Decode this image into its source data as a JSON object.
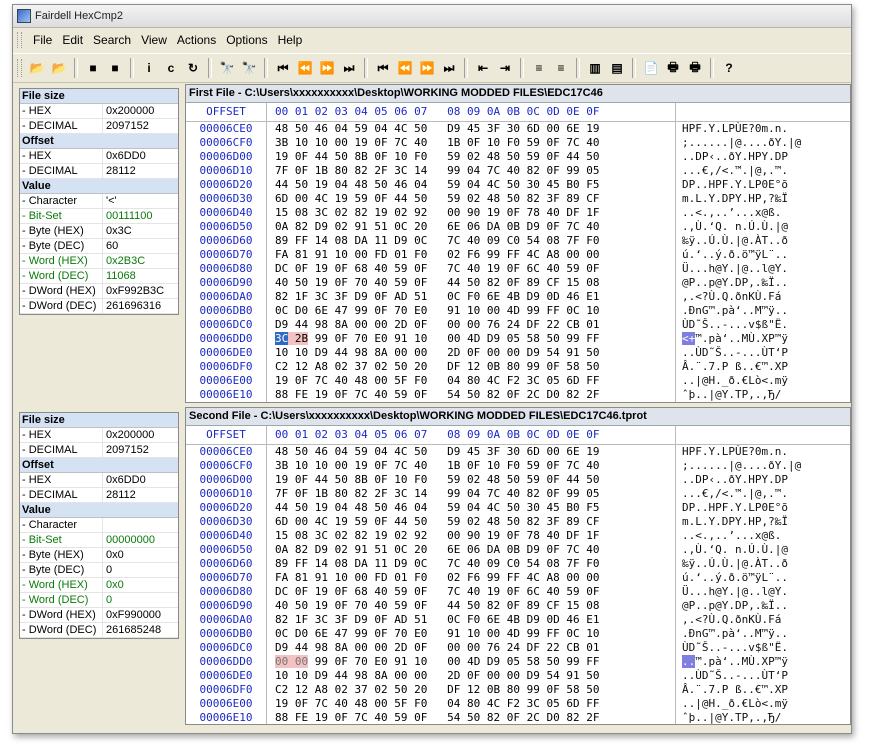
{
  "window": {
    "title": "Fairdell HexCmp2"
  },
  "menu": [
    "File",
    "Edit",
    "Search",
    "View",
    "Actions",
    "Options",
    "Help"
  ],
  "toolbar": [
    {
      "name": "open-first-icon",
      "glyph": "📂"
    },
    {
      "name": "open-second-icon",
      "glyph": "📂"
    },
    {
      "sep": true
    },
    {
      "name": "stop-icon",
      "glyph": "■"
    },
    {
      "name": "stop2-icon",
      "glyph": "■"
    },
    {
      "sep": true
    },
    {
      "name": "info-icon",
      "glyph": "i"
    },
    {
      "name": "compare-icon",
      "glyph": "c"
    },
    {
      "name": "refresh-icon",
      "glyph": "↻"
    },
    {
      "sep": true
    },
    {
      "name": "find-icon",
      "glyph": "🔭"
    },
    {
      "name": "find-next-icon",
      "glyph": "🔭"
    },
    {
      "sep": true
    },
    {
      "name": "first-diff-icon",
      "glyph": "⏮"
    },
    {
      "name": "prev-diff-icon",
      "glyph": "⏪"
    },
    {
      "name": "next-diff-icon",
      "glyph": "⏩"
    },
    {
      "name": "last-diff-icon",
      "glyph": "⏭"
    },
    {
      "sep": true
    },
    {
      "name": "first-block-icon",
      "glyph": "⏮"
    },
    {
      "name": "prev-block-icon",
      "glyph": "⏪"
    },
    {
      "name": "next-block-icon",
      "glyph": "⏩"
    },
    {
      "name": "last-block-icon",
      "glyph": "⏭"
    },
    {
      "sep": true
    },
    {
      "name": "sync-left-icon",
      "glyph": "⇤"
    },
    {
      "name": "sync-right-icon",
      "glyph": "⇥"
    },
    {
      "sep": true
    },
    {
      "name": "align-top-icon",
      "glyph": "≡"
    },
    {
      "name": "align-bottom-icon",
      "glyph": "≡"
    },
    {
      "sep": true
    },
    {
      "name": "columns-icon",
      "glyph": "▥"
    },
    {
      "name": "rows-icon",
      "glyph": "▤"
    },
    {
      "sep": true
    },
    {
      "name": "report-icon",
      "glyph": "📄"
    },
    {
      "name": "print-icon",
      "glyph": "🖶"
    },
    {
      "name": "print-preview-icon",
      "glyph": "🖶"
    },
    {
      "sep": true
    },
    {
      "name": "help-icon",
      "glyph": "?"
    }
  ],
  "col_header": {
    "offset": "OFFSET",
    "hex": "00 01 02 03 04 05 06 07   08 09 0A 0B 0C 0D 0E 0F"
  },
  "panels": [
    {
      "title": "First File - C:\\Users\\xxxxxxxxxx\\Desktop\\WORKING MODDED FILES\\EDC17C46",
      "info": [
        {
          "h": "File size"
        },
        {
          "k": " - HEX",
          "v": "0x200000"
        },
        {
          "k": " - DECIMAL",
          "v": "2097152"
        },
        {
          "h": "Offset"
        },
        {
          "k": " - HEX",
          "v": "0x6DD0"
        },
        {
          "k": " - DECIMAL",
          "v": "28112"
        },
        {
          "h": "Value"
        },
        {
          "k": " - Character",
          "v": "'<'"
        },
        {
          "k": " - Bit-Set",
          "v": "00111100",
          "g": true
        },
        {
          "k": " - Byte (HEX)",
          "v": "0x3C"
        },
        {
          "k": " - Byte (DEC)",
          "v": "60"
        },
        {
          "k": " - Word (HEX)",
          "v": "0x2B3C",
          "g": true
        },
        {
          "k": " - Word (DEC)",
          "v": "11068",
          "g": true
        },
        {
          "k": " - DWord (HEX)",
          "v": "0xF992B3C"
        },
        {
          "k": " - DWord (DEC)",
          "v": "261696316"
        }
      ],
      "rows": [
        [
          "00006CE0",
          "48 50 46 04 59 04 4C 50   D9 45 3F 30 6D 00 6E 19",
          "HPF.Y.LPÙE?0m.n."
        ],
        [
          "00006CF0",
          "3B 10 10 00 19 0F 7C 40   1B 0F 10 F0 59 0F 7C 40",
          ";......|@....ðY.|@"
        ],
        [
          "00006D00",
          "19 0F 44 50 8B 0F 10 F0   59 02 48 50 59 0F 44 50",
          "..DP‹..ðY.HPY.DP"
        ],
        [
          "00006D10",
          "7F 0F 1B 80 82 2F 3C 14   99 04 7C 40 82 0F 99 05",
          "...€‚/<.™.|@‚.™."
        ],
        [
          "00006D20",
          "44 50 19 04 48 50 46 04   59 04 4C 50 30 45 B0 F5",
          "DP..HPF.Y.LP0E°õ"
        ],
        [
          "00006D30",
          "6D 00 4C 19 59 0F 44 50   59 02 48 50 82 3F 89 CF",
          "m.L.Y.DPY.HP‚?‰Ï"
        ],
        [
          "00006D40",
          "15 08 3C 02 82 19 02 92   00 90 19 0F 78 40 DF 1F",
          "..<.‚..’...x@ß."
        ],
        [
          "00006D50",
          "0A 82 D9 02 91 51 0C 20   6E 06 DA 0B D9 0F 7C 40",
          ".‚Ù.‘Q. n.Ú.Ù.|@"
        ],
        [
          "00006D60",
          "89 FF 14 08 DA 11 D9 0C   7C 40 09 C0 54 08 7F F0",
          "‰ÿ..Ú.Ù.|@.ÀT..ð"
        ],
        [
          "00006D70",
          "FA 81 91 10 00 FD 01 F0   02 F6 99 FF 4C A8 00 00",
          "ú.‘..ý.ð.ö™ÿL¨.."
        ],
        [
          "00006D80",
          "DC 0F 19 0F 68 40 59 0F   7C 40 19 0F 6C 40 59 0F",
          "Ü...h@Y.|@..l@Y."
        ],
        [
          "00006D90",
          "40 50 19 0F 70 40 59 0F   44 50 82 0F 89 CF 15 08",
          "@P..p@Y.DP‚.‰Ï.."
        ],
        [
          "00006DA0",
          "82 1F 3C 3F D9 0F AD 51   0C F0 6E 4B D9 0D 46 E1",
          "‚.<?Ù.­Q.ðnKÙ.Fá"
        ],
        [
          "00006DB0",
          "0C D0 6E 47 99 0F 70 E0   91 10 00 4D 99 FF 0C 10",
          ".ÐnG™.pà‘..M™ÿ.."
        ],
        [
          "00006DC0",
          "D9 44 98 8A 00 00 2D 0F   00 00 76 24 DF 22 CB 01",
          "ÙD˜Š..-...v$ß\"Ë."
        ],
        [
          "00006DD0",
          "3C 2B 99 0F 70 E0 91 10   00 4D D9 05 58 50 99 FF",
          "<+™.pà‘..MÙ.XP™ÿ"
        ],
        [
          "00006DE0",
          "10 10 D9 44 98 8A 00 00   2D 0F 00 00 D9 54 91 50",
          "..ÙD˜Š..-...ÙT‘P"
        ],
        [
          "00006DF0",
          "C2 12 A8 02 37 02 50 20   DF 12 0B 80 99 0F 58 50",
          "Â.¨.7.P ß..€™.XP"
        ],
        [
          "00006E00",
          "19 0F 7C 40 48 00 5F F0   04 80 4C F2 3C 05 6D FF",
          "..|@H._ð.€Lò<.mÿ"
        ],
        [
          "00006E10",
          "88 FE 19 0F 7C 40 59 0F   54 50 82 0F 2C D0 82 2F",
          "ˆþ..|@Y.TP‚.,Ђ/"
        ],
        [
          "00006E20",
          "89 CF 14 08 00 90 DA 10   D9 0F 47 E1 89 CF 14 08",
          "‰Ï.....Ú.Ù.Gá‰Ï.."
        ]
      ],
      "diff_row": 15
    },
    {
      "title": "Second File - C:\\Users\\xxxxxxxxxx\\Desktop\\WORKING MODDED FILES\\EDC17C46.tprot",
      "info": [
        {
          "h": "File size"
        },
        {
          "k": " - HEX",
          "v": "0x200000"
        },
        {
          "k": " - DECIMAL",
          "v": "2097152"
        },
        {
          "h": "Offset"
        },
        {
          "k": " - HEX",
          "v": "0x6DD0"
        },
        {
          "k": " - DECIMAL",
          "v": "28112"
        },
        {
          "h": "Value"
        },
        {
          "k": " - Character",
          "v": ""
        },
        {
          "k": " - Bit-Set",
          "v": "00000000",
          "g": true
        },
        {
          "k": " - Byte (HEX)",
          "v": "0x0"
        },
        {
          "k": " - Byte (DEC)",
          "v": "0"
        },
        {
          "k": " - Word (HEX)",
          "v": "0x0",
          "g": true
        },
        {
          "k": " - Word (DEC)",
          "v": "0",
          "g": true
        },
        {
          "k": " - DWord (HEX)",
          "v": "0xF990000"
        },
        {
          "k": " - DWord (DEC)",
          "v": "261685248"
        }
      ],
      "rows": [
        [
          "00006CE0",
          "48 50 46 04 59 04 4C 50   D9 45 3F 30 6D 00 6E 19",
          "HPF.Y.LPÙE?0m.n."
        ],
        [
          "00006CF0",
          "3B 10 10 00 19 0F 7C 40   1B 0F 10 F0 59 0F 7C 40",
          ";......|@....ðY.|@"
        ],
        [
          "00006D00",
          "19 0F 44 50 8B 0F 10 F0   59 02 48 50 59 0F 44 50",
          "..DP‹..ðY.HPY.DP"
        ],
        [
          "00006D10",
          "7F 0F 1B 80 82 2F 3C 14   99 04 7C 40 82 0F 99 05",
          "...€‚/<.™.|@‚.™."
        ],
        [
          "00006D20",
          "44 50 19 04 48 50 46 04   59 04 4C 50 30 45 B0 F5",
          "DP..HPF.Y.LP0E°õ"
        ],
        [
          "00006D30",
          "6D 00 4C 19 59 0F 44 50   59 02 48 50 82 3F 89 CF",
          "m.L.Y.DPY.HP‚?‰Ï"
        ],
        [
          "00006D40",
          "15 08 3C 02 82 19 02 92   00 90 19 0F 78 40 DF 1F",
          "..<.‚..’...x@ß."
        ],
        [
          "00006D50",
          "0A 82 D9 02 91 51 0C 20   6E 06 DA 0B D9 0F 7C 40",
          ".‚Ù.‘Q. n.Ú.Ù.|@"
        ],
        [
          "00006D60",
          "89 FF 14 08 DA 11 D9 0C   7C 40 09 C0 54 08 7F F0",
          "‰ÿ..Ú.Ù.|@.ÀT..ð"
        ],
        [
          "00006D70",
          "FA 81 91 10 00 FD 01 F0   02 F6 99 FF 4C A8 00 00",
          "ú.‘..ý.ð.ö™ÿL¨.."
        ],
        [
          "00006D80",
          "DC 0F 19 0F 68 40 59 0F   7C 40 19 0F 6C 40 59 0F",
          "Ü...h@Y.|@..l@Y."
        ],
        [
          "00006D90",
          "40 50 19 0F 70 40 59 0F   44 50 82 0F 89 CF 15 08",
          "@P..p@Y.DP‚.‰Ï.."
        ],
        [
          "00006DA0",
          "82 1F 3C 3F D9 0F AD 51   0C F0 6E 4B D9 0D 46 E1",
          "‚.<?Ù.­Q.ðnKÙ.Fá"
        ],
        [
          "00006DB0",
          "0C D0 6E 47 99 0F 70 E0   91 10 00 4D 99 FF 0C 10",
          ".ÐnG™.pà‘..M™ÿ.."
        ],
        [
          "00006DC0",
          "D9 44 98 8A 00 00 2D 0F   00 00 76 24 DF 22 CB 01",
          "ÙD˜Š..-...v$ß\"Ë."
        ],
        [
          "00006DD0",
          "00 00 99 0F 70 E0 91 10   00 4D D9 05 58 50 99 FF",
          "..™.pà‘..MÙ.XP™ÿ"
        ],
        [
          "00006DE0",
          "10 10 D9 44 98 8A 00 00   2D 0F 00 00 D9 54 91 50",
          "..ÙD˜Š..-...ÙT‘P"
        ],
        [
          "00006DF0",
          "C2 12 A8 02 37 02 50 20   DF 12 0B 80 99 0F 58 50",
          "Â.¨.7.P ß..€™.XP"
        ],
        [
          "00006E00",
          "19 0F 7C 40 48 00 5F F0   04 80 4C F2 3C 05 6D FF",
          "..|@H._ð.€Lò<.mÿ"
        ],
        [
          "00006E10",
          "88 FE 19 0F 7C 40 59 0F   54 50 82 0F 2C D0 82 2F",
          "ˆþ..|@Y.TP‚.,Ђ/"
        ],
        [
          "00006E20",
          "89 CF 14 08 00 90 DA 10   D9 0F 47 E1 89 CF 14 08",
          "‰Ï.....Ú.Ù.Gá‰Ï.."
        ]
      ],
      "diff_row": 15
    }
  ],
  "colors": {
    "offset_blue": "#1a28c8",
    "diff_bg": "#f4c2c2",
    "selection": "#316ac5",
    "value_green": "#0a7a0a"
  }
}
